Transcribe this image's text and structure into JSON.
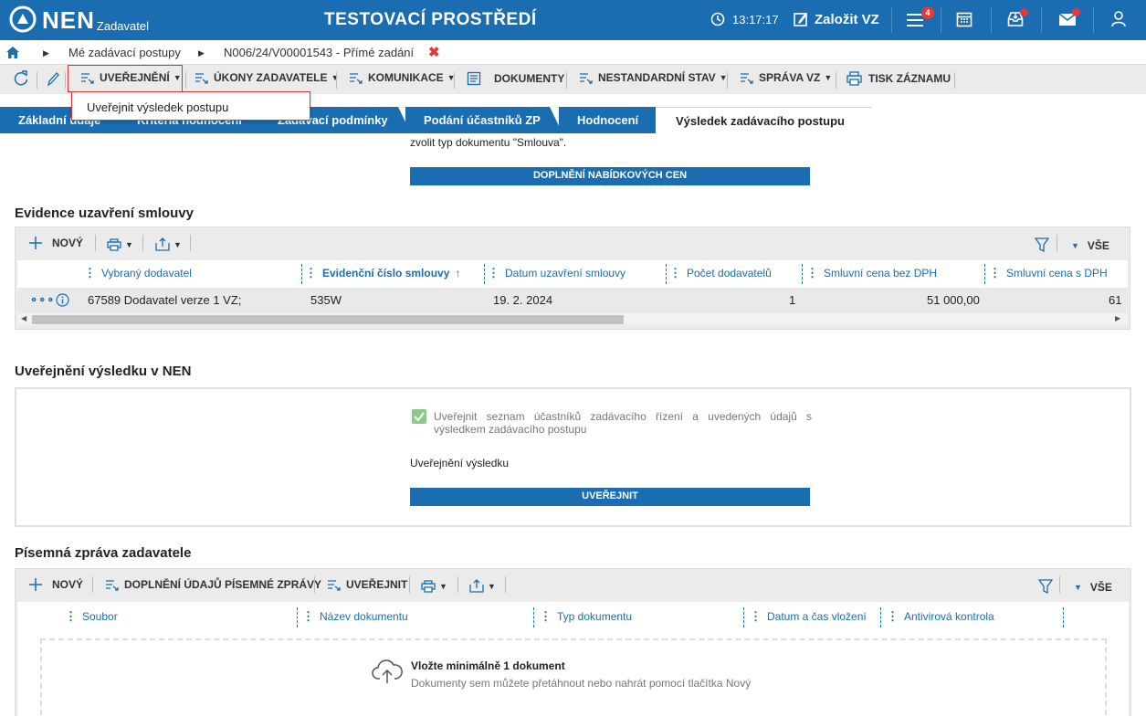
{
  "topbar": {
    "logo_text": "NEN",
    "logo_sub": "Zadavatel",
    "environment": "TESTOVACÍ PROSTŘEDÍ",
    "time": "13:17:17",
    "create_label": "Založit VZ",
    "notification_count": "4"
  },
  "breadcrumb": {
    "item1": "Mé zadávací postupy",
    "item2": "N006/24/V00001543 - Přímé zadání"
  },
  "toolbar": {
    "publish": "UVEŘEJNĚNÍ",
    "actions": "ÚKONY ZADAVATELE",
    "communication": "KOMUNIKACE",
    "documents": "DOKUMENTY",
    "nonstandard": "NESTANDARDNÍ STAV",
    "management": "SPRÁVA VZ",
    "print": "TISK ZÁZNAMU"
  },
  "dropdown": {
    "item": "Uveřejnit výsledek postupu"
  },
  "tabs": [
    {
      "label": "Základní údaje"
    },
    {
      "label": "Kritéria hodnocení"
    },
    {
      "label": "Zadávací podmínky"
    },
    {
      "label": "Podání účastníků ZP"
    },
    {
      "label": "Hodnocení"
    },
    {
      "label": "Výsledek zadávacího postupu"
    }
  ],
  "content": {
    "note": "zvolit typ dokumentu \"Smlouva\".",
    "supplement_button": "DOPLNĚNÍ NABÍDKOVÝCH CEN"
  },
  "contract": {
    "title": "Evidence uzavření smlouvy",
    "new": "NOVÝ",
    "all": "VŠE",
    "columns": [
      "Vybraný dodavatel",
      "Evidenční číslo smlouvy",
      "Datum uzavření smlouvy",
      "Počet dodavatelů",
      "Smluvní cena bez DPH",
      "Smluvní cena s DPH"
    ],
    "row": {
      "supplier": "67589 Dodavatel verze 1 VZ;",
      "number": "535W",
      "date": "19. 2. 2024",
      "count": "1",
      "price": "51 000,00",
      "price_vat": "61"
    }
  },
  "publish_result": {
    "title": "Uveřejnění výsledku v NEN",
    "checkbox_label": "Uveřejnit seznam účastníků zadávacího řízení a uvedených údajů s výsledkem zadávacího postupu",
    "subtitle": "Uveřejnění výsledku",
    "button": "UVEŘEJNIT"
  },
  "report": {
    "title": "Písemná zpráva zadavatele",
    "new": "NOVÝ",
    "supplement": "DOPLNĚNÍ ÚDAJŮ PÍSEMNÉ ZPRÁVY",
    "publish": "UVEŘEJNIT",
    "all": "VŠE",
    "columns": [
      "Soubor",
      "Název dokumentu",
      "Typ dokumentu",
      "Datum a čas vložení",
      "Antivirová kontrola"
    ],
    "drop_title": "Vložte minimálně 1 dokument",
    "drop_hint": "Dokumenty sem můžete přetáhnout nebo nahrát pomocí tlačítka Nový"
  },
  "colors": {
    "primary": "#1a6db0",
    "alert": "#e53935",
    "checkbox": "#8bc98b"
  }
}
